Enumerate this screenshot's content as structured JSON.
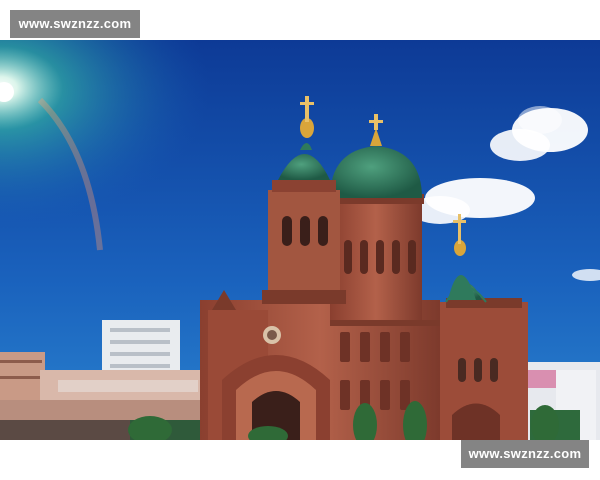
{
  "watermark": {
    "top_text": "www.swznzz.com",
    "bottom_text": "www.swznzz.com"
  },
  "photo": {
    "subject": "onion-dome-cathedral",
    "colors": {
      "sky_top": "#0f3f9c",
      "sky_bottom": "#1f72c8",
      "brick": "#a4543d",
      "brick_dark": "#6e3226",
      "dome_green": "#2f7a5c",
      "gold": "#d9a53a",
      "cloud": "#ffffff"
    }
  }
}
